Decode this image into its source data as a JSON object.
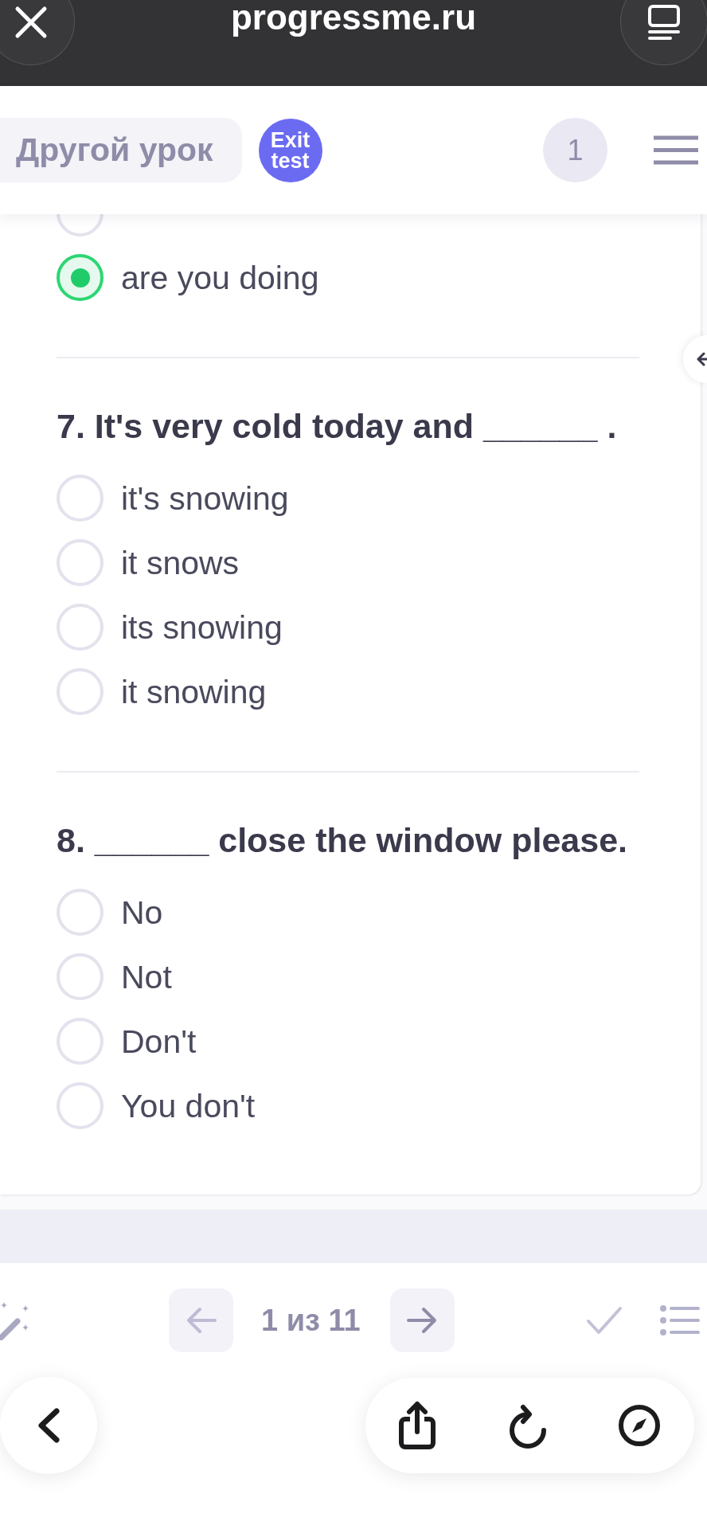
{
  "browser": {
    "address": "progressme.ru"
  },
  "header": {
    "lesson_button": "Другой урок",
    "exit_button": "Exit test",
    "counter": "1"
  },
  "questions": [
    {
      "options": [
        {
          "selected": false
        },
        {
          "label": "are you doing",
          "selected": true
        }
      ]
    },
    {
      "prompt": "7. It's very cold today and ______ .",
      "options": [
        {
          "label": "it's snowing",
          "selected": false
        },
        {
          "label": "it snows",
          "selected": false
        },
        {
          "label": "its snowing",
          "selected": false
        },
        {
          "label": "it snowing",
          "selected": false
        }
      ]
    },
    {
      "prompt": "8. ______ close the window please.",
      "options": [
        {
          "label": "No",
          "selected": false
        },
        {
          "label": "Not",
          "selected": false
        },
        {
          "label": "Don't",
          "selected": false
        },
        {
          "label": "You don't",
          "selected": false
        }
      ]
    }
  ],
  "pager": {
    "position": "1 из 11",
    "prev_disabled": true,
    "next_disabled": false
  }
}
